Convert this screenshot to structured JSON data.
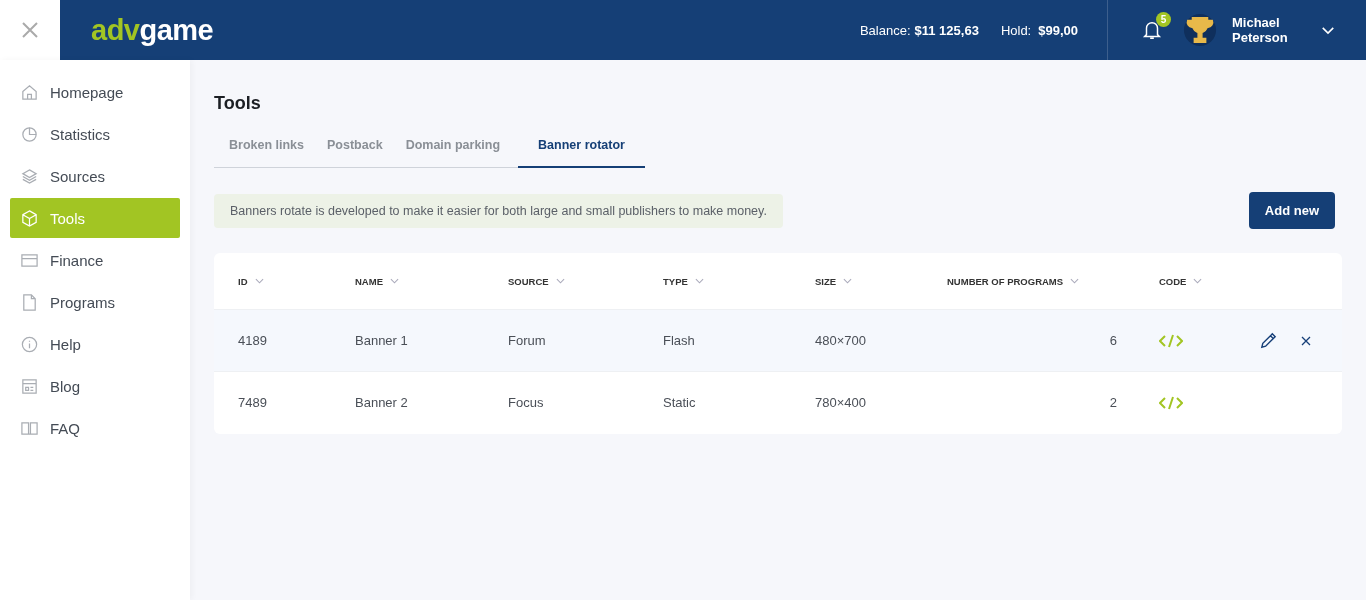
{
  "logo": {
    "part_1": "adv",
    "part_2": "game"
  },
  "header": {
    "balance_label": "Balance:",
    "balance": "$11 125,63",
    "hold_label": "Hold:",
    "hold": "$99,00",
    "notifications": "5",
    "user_first": "Michael",
    "user_last": "Peterson"
  },
  "sidebar": {
    "items": [
      {
        "label": "Homepage",
        "selected": false
      },
      {
        "label": "Statistics",
        "selected": false
      },
      {
        "label": "Sources",
        "selected": false
      },
      {
        "label": "Tools",
        "selected": true
      },
      {
        "label": "Finance",
        "selected": false
      },
      {
        "label": "Programs",
        "selected": false
      },
      {
        "label": "Help",
        "selected": false
      },
      {
        "label": "Blog",
        "selected": false
      },
      {
        "label": "FAQ",
        "selected": false
      }
    ]
  },
  "page_title": "Tools",
  "tabs": [
    {
      "label": "Broken links",
      "selected": false
    },
    {
      "label": "Postback",
      "selected": false
    },
    {
      "label": "Domain parking",
      "selected": false
    },
    {
      "label": "Banner rotator",
      "selected": true
    }
  ],
  "notice": "Banners rotate is developed to make it easier for both large and small publishers to make money.",
  "add_button": "Add new",
  "table": {
    "columns": [
      "ID",
      "NAME",
      "SOURCE",
      "TYPE",
      "SIZE",
      "NUMBER OF PROGRAMS",
      "CODE"
    ],
    "rows": [
      {
        "cells": [
          "4189",
          "Banner 1",
          "Forum",
          "Flash",
          "480×700",
          "6"
        ],
        "selected": true
      },
      {
        "cells": [
          "7489",
          "Banner 2",
          "Focus",
          "Static",
          "780×400",
          "2"
        ],
        "selected": false
      }
    ]
  }
}
